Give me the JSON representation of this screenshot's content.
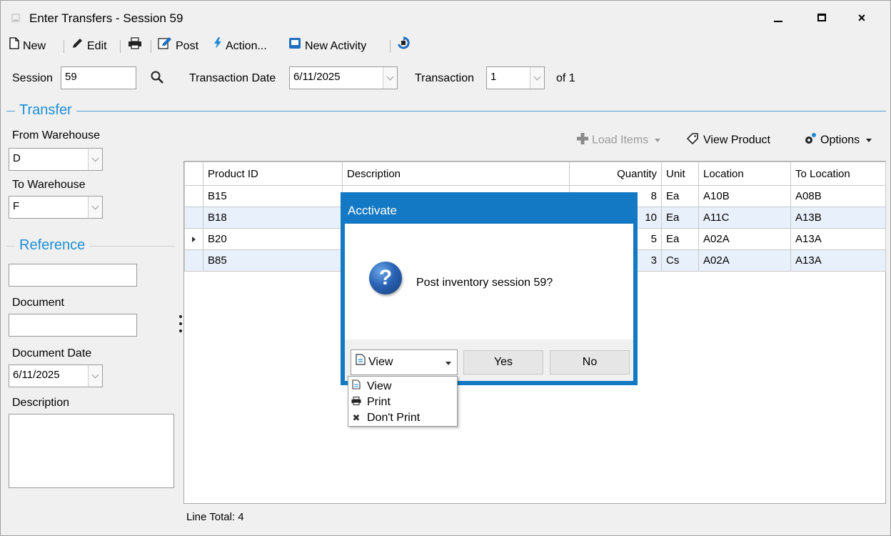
{
  "window": {
    "title": "Enter Transfers - Session 59",
    "controls": {
      "minimize": "minimize",
      "maximize": "maximize",
      "close": "×"
    }
  },
  "toolbar": {
    "new": "New",
    "edit": "Edit",
    "post": "Post",
    "action": "Action...",
    "new_activity": "New Activity"
  },
  "header": {
    "session_label": "Session",
    "session_value": "59",
    "transaction_date_label": "Transaction Date",
    "transaction_date_value": "6/11/2025",
    "transaction_label": "Transaction",
    "transaction_value": "1",
    "of_label": "of 1"
  },
  "transfer": {
    "section_title": "Transfer",
    "from_label": "From Warehouse",
    "from_value": "D",
    "to_label": "To Warehouse",
    "to_value": "F"
  },
  "reference": {
    "section_title": "Reference",
    "reference_value": "",
    "document_label": "Document",
    "document_value": "",
    "document_date_label": "Document Date",
    "document_date_value": "6/11/2025",
    "description_label": "Description",
    "description_value": ""
  },
  "grid_tools": {
    "load_items": "Load Items",
    "view_product": "View Product",
    "options": "Options"
  },
  "grid": {
    "columns": [
      "Product ID",
      "Description",
      "Quantity",
      "Unit",
      "Location",
      "To Location"
    ],
    "rows": [
      {
        "product_id": "B15",
        "description": "",
        "quantity": "8",
        "unit": "Ea",
        "location": "A10B",
        "to_location": "A08B"
      },
      {
        "product_id": "B18",
        "description": "",
        "quantity": "10",
        "unit": "Ea",
        "location": "A11C",
        "to_location": "A13B"
      },
      {
        "product_id": "B20",
        "description": "",
        "quantity": "5",
        "unit": "Ea",
        "location": "A02A",
        "to_location": "A13A"
      },
      {
        "product_id": "B85",
        "description": "",
        "quantity": "3",
        "unit": "Cs",
        "location": "A02A",
        "to_location": "A13A"
      }
    ],
    "line_total": "Line Total: 4"
  },
  "dialog": {
    "title": "Acctivate",
    "message": "Post inventory session 59?",
    "view_selected": "View",
    "yes": "Yes",
    "no": "No",
    "options": [
      "View",
      "Print",
      "Don't Print"
    ]
  },
  "colors": {
    "accent": "#1479c4",
    "section": "#1e8fd6",
    "alt_row": "#e8f1fb"
  }
}
